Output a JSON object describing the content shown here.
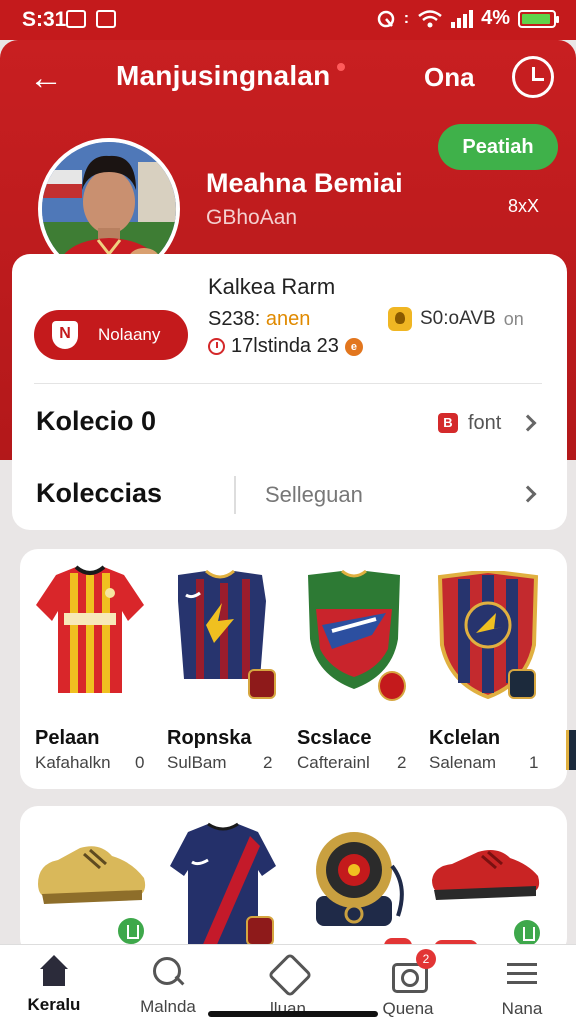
{
  "status_bar": {
    "time": "S:31",
    "battery_text": "4%",
    "battery_level": 0.92,
    "icons": [
      "gallery-icon",
      "image-icon",
      "alarm-icon",
      "wifi-icon",
      "signal-icon",
      "battery-icon"
    ]
  },
  "header": {
    "title": "Manjusingnalan",
    "action_label": "Ona",
    "follow_label": "Peatiah"
  },
  "profile": {
    "name": "Meahna Bemiai",
    "handle": "GBhoAan",
    "extra": "8xX"
  },
  "info": {
    "team_name": "Kalkea Rarm",
    "member_label": "Nolaany",
    "member_shield": "N",
    "stat_prefix": "S238:",
    "stat_highlight": "anen",
    "stat2_text": "17lstinda 23",
    "coin_symbol": "e",
    "score_text": "S0:oAVB",
    "score_suffix": "on"
  },
  "rows": [
    {
      "title": "Kolecio 0",
      "link_badge": "B",
      "link_label": "font"
    },
    {
      "title": "Koleccias",
      "select_label": "Selleguan"
    }
  ],
  "collection": [
    {
      "name": "Pelaan",
      "sub": "Kafahalkn",
      "count": "0"
    },
    {
      "name": "Ropnska",
      "sub": "SulBam",
      "count": "2"
    },
    {
      "name": "Scslace",
      "sub": "Cafterainl",
      "count": "2"
    },
    {
      "name": "Kclelan",
      "sub": "Salenam",
      "count": "1"
    }
  ],
  "nav": [
    {
      "label": "Keralu",
      "icon": "home-icon"
    },
    {
      "label": "Malnda",
      "icon": "search-icon"
    },
    {
      "label": "lluan",
      "icon": "shirt-icon"
    },
    {
      "label": "Quena",
      "icon": "camera-icon",
      "badge": "2"
    },
    {
      "label": "Nana",
      "icon": "menu-icon"
    }
  ],
  "colors": {
    "brand_red": "#c41a1c",
    "follow_green": "#3fb14a",
    "accent_orange": "#e08a00"
  }
}
